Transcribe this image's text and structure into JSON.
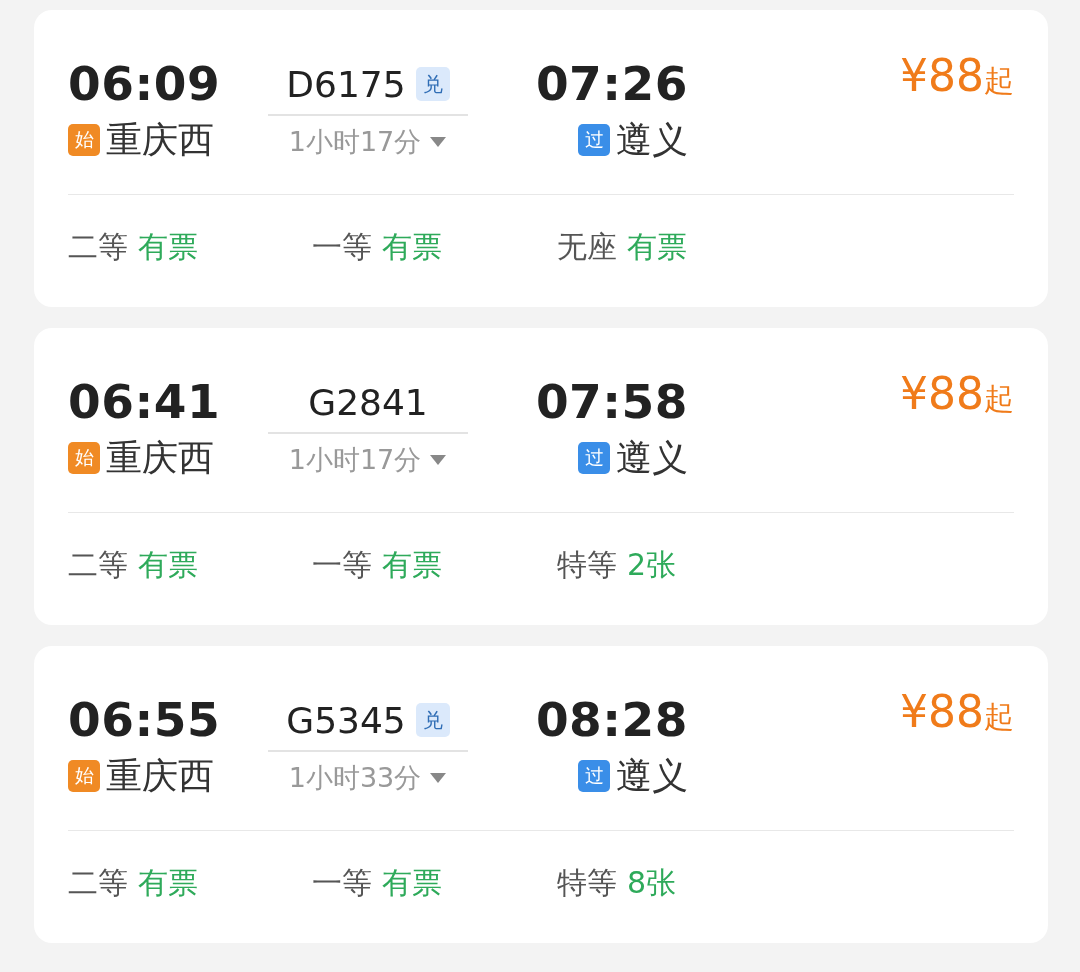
{
  "trains": [
    {
      "depart_time": "06:09",
      "depart_badge": "始",
      "depart_station": "重庆西",
      "train_no": "D6175",
      "exchange_badge": "兑",
      "duration": "1小时17分",
      "arrive_time": "07:26",
      "arrive_badge": "过",
      "arrive_station": "遵义",
      "price": "¥88",
      "price_suffix": "起",
      "seats": [
        {
          "class": "二等",
          "availability": "有票"
        },
        {
          "class": "一等",
          "availability": "有票"
        },
        {
          "class": "无座",
          "availability": "有票"
        }
      ]
    },
    {
      "depart_time": "06:41",
      "depart_badge": "始",
      "depart_station": "重庆西",
      "train_no": "G2841",
      "duration": "1小时17分",
      "arrive_time": "07:58",
      "arrive_badge": "过",
      "arrive_station": "遵义",
      "price": "¥88",
      "price_suffix": "起",
      "seats": [
        {
          "class": "二等",
          "availability": "有票"
        },
        {
          "class": "一等",
          "availability": "有票"
        },
        {
          "class": "特等",
          "availability": "2张"
        }
      ]
    },
    {
      "depart_time": "06:55",
      "depart_badge": "始",
      "depart_station": "重庆西",
      "train_no": "G5345",
      "exchange_badge": "兑",
      "duration": "1小时33分",
      "arrive_time": "08:28",
      "arrive_badge": "过",
      "arrive_station": "遵义",
      "price": "¥88",
      "price_suffix": "起",
      "seats": [
        {
          "class": "二等",
          "availability": "有票"
        },
        {
          "class": "一等",
          "availability": "有票"
        },
        {
          "class": "特等",
          "availability": "8张"
        }
      ]
    }
  ]
}
